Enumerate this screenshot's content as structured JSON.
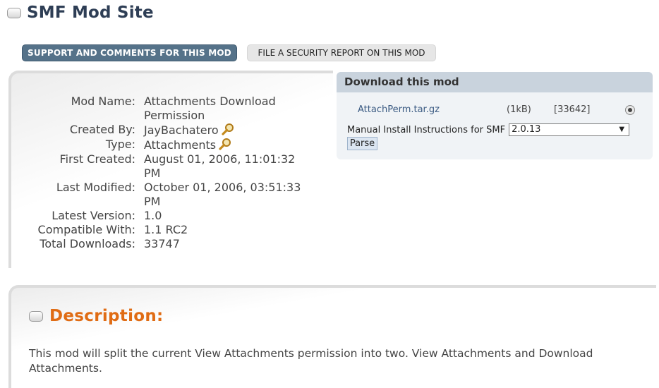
{
  "header": {
    "title": "SMF Mod Site"
  },
  "buttons": {
    "support": "SUPPORT AND COMMENTS FOR THIS MOD",
    "security": "FILE A SECURITY REPORT ON THIS MOD"
  },
  "mod_info": {
    "rows": [
      {
        "label": "Mod Name:",
        "value": "Attachments Download Permission"
      },
      {
        "label": "Created By:",
        "value": "JayBachatero"
      },
      {
        "label": "Type:",
        "value": "Attachments"
      },
      {
        "label": "First Created:",
        "value": "August 01, 2006, 11:01:32 PM"
      },
      {
        "label": "Last Modified:",
        "value": "October 01, 2006, 03:51:33 PM"
      },
      {
        "label": "Latest Version:",
        "value": "1.0"
      },
      {
        "label": "Compatible With:",
        "value": "1.1 RC2"
      },
      {
        "label": "Total Downloads:",
        "value": "33747"
      }
    ]
  },
  "download": {
    "header": "Download this mod",
    "file": {
      "name": "AttachPerm.tar.gz",
      "size": "(1kB)",
      "downloads": "[33642]"
    },
    "install_label": "Manual Install Instructions for SMF",
    "install_version": "2.0.13",
    "parse_label": "Parse"
  },
  "description": {
    "title": "Description:",
    "body": "This mod will split the current View Attachments permission into two.  View Attachments and Download Attachments."
  },
  "icons": {
    "magnifier": "magnifier-icon",
    "toggle": "collapse-toggle-icon",
    "dropdown": "dropdown-arrow-icon"
  }
}
